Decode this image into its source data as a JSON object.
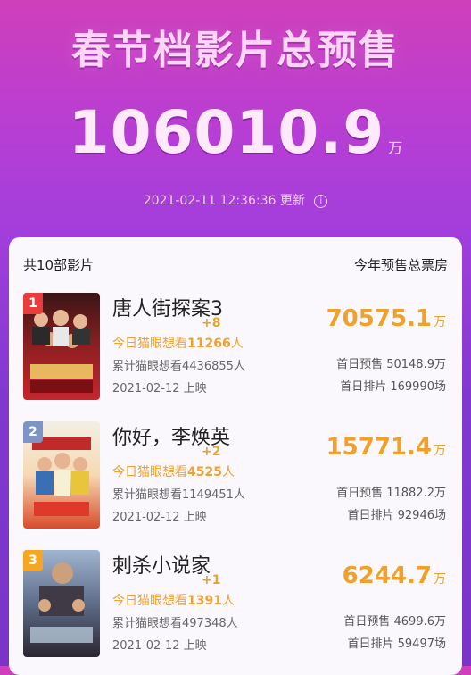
{
  "hero": {
    "title": "春节档影片总预售",
    "total_value": "106010.9",
    "total_unit": "万",
    "timestamp": "2021-02-11 12:36:36 更新",
    "info_icon": "i"
  },
  "list": {
    "count_label": "共10部影片",
    "column_label": "今年预售总票房",
    "movies": [
      {
        "rank": "1",
        "title": "唐人街探案3",
        "today_increase": "+8",
        "today_want_prefix": "今日猫眼想看",
        "today_want_count": "11266",
        "today_want_suffix": "人",
        "total_want": "累计猫眼想看4436855人",
        "release": "2021-02-12 上映",
        "box_value": "70575.1",
        "box_unit": "万",
        "first_day_presale": "首日预售 50148.9万",
        "first_day_schedule": "首日排片 169990场",
        "poster_theme": "#c6262d"
      },
      {
        "rank": "2",
        "title": "你好，李焕英",
        "today_increase": "+2",
        "today_want_prefix": "今日猫眼想看",
        "today_want_count": "4525",
        "today_want_suffix": "人",
        "total_want": "累计猫眼想看1149451人",
        "release": "2021-02-12 上映",
        "box_value": "15771.4",
        "box_unit": "万",
        "first_day_presale": "首日预售 11882.2万",
        "first_day_schedule": "首日排片 92946场",
        "poster_theme": "#d84b2b"
      },
      {
        "rank": "3",
        "title": "刺杀小说家",
        "today_increase": "+1",
        "today_want_prefix": "今日猫眼想看",
        "today_want_count": "1391",
        "today_want_suffix": "人",
        "total_want": "累计猫眼想看497348人",
        "release": "2021-02-12 上映",
        "box_value": "6244.7",
        "box_unit": "万",
        "first_day_presale": "首日预售 4699.6万",
        "first_day_schedule": "首日排片 59497场",
        "poster_theme": "#5e6d8a"
      }
    ]
  },
  "colors": {
    "accent_orange": "#f0a129",
    "rank1": "#ea3c3c",
    "rank2": "#7d95c6",
    "rank3": "#f5a623"
  }
}
